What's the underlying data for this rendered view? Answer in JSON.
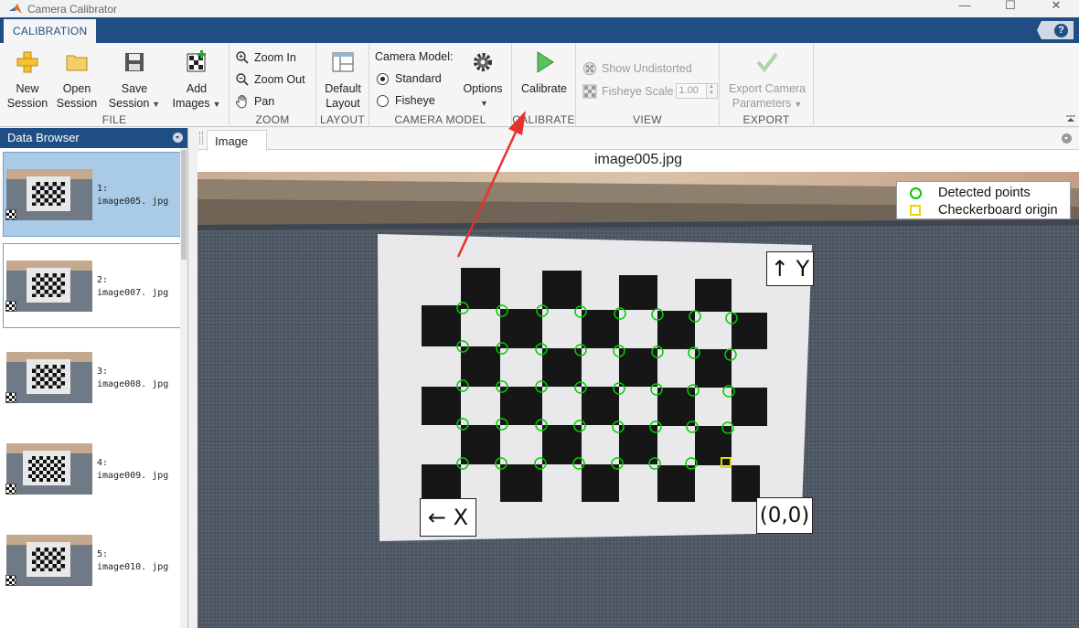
{
  "window": {
    "title": "Camera Calibrator",
    "controls": {
      "minimize": "—",
      "maximize": "☐",
      "close": "✕"
    }
  },
  "ribbon_tab": {
    "label": "CALIBRATION"
  },
  "help": {
    "label": "?"
  },
  "groups": {
    "file": {
      "label": "FILE",
      "new_session": {
        "line1": "New",
        "line2": "Session"
      },
      "open_session": {
        "line1": "Open",
        "line2": "Session"
      },
      "save_session": {
        "line1": "Save",
        "line2": "Session"
      },
      "add_images": {
        "line1": "Add",
        "line2": "Images"
      }
    },
    "zoom": {
      "label": "ZOOM",
      "zoom_in": "Zoom In",
      "zoom_out": "Zoom Out",
      "pan": "Pan"
    },
    "layout": {
      "label": "LAYOUT",
      "default_layout": {
        "line1": "Default",
        "line2": "Layout"
      }
    },
    "camera_model": {
      "label": "CAMERA MODEL",
      "heading": "Camera Model:",
      "standard": "Standard",
      "fisheye": "Fisheye",
      "selected": "Standard",
      "options": "Options"
    },
    "calibrate": {
      "label": "CALIBRATE",
      "calibrate": "Calibrate"
    },
    "view": {
      "label": "VIEW",
      "show_undistorted": "Show Undistorted",
      "fisheye_scale": "Fisheye Scale",
      "fisheye_scale_value": "1.00"
    },
    "export": {
      "label": "EXPORT",
      "export_camera": {
        "line1": "Export Camera",
        "line2": "Parameters"
      }
    }
  },
  "data_browser": {
    "title": "Data Browser",
    "items": [
      {
        "index": "1:",
        "name": "image005. jpg",
        "selected": true
      },
      {
        "index": "2:",
        "name": "image007. jpg",
        "selected": false
      },
      {
        "index": "3:",
        "name": "image008. jpg",
        "selected": false
      },
      {
        "index": "4:",
        "name": "image009. jpg",
        "selected": false
      },
      {
        "index": "5:",
        "name": "image010. jpg",
        "selected": false
      }
    ]
  },
  "document": {
    "tab": "Image",
    "image_title": "image005.jpg",
    "legend": {
      "detected": "Detected points",
      "origin": "Checkerboard origin"
    },
    "labels": {
      "y_axis": "↑ Y",
      "x_axis": "← X",
      "origin": "(0,0)"
    }
  },
  "colors": {
    "accent": "#1f4e84",
    "detected_marker": "#00cc00",
    "origin_marker": "#e8d800",
    "annotation_arrow": "#e8312c"
  }
}
